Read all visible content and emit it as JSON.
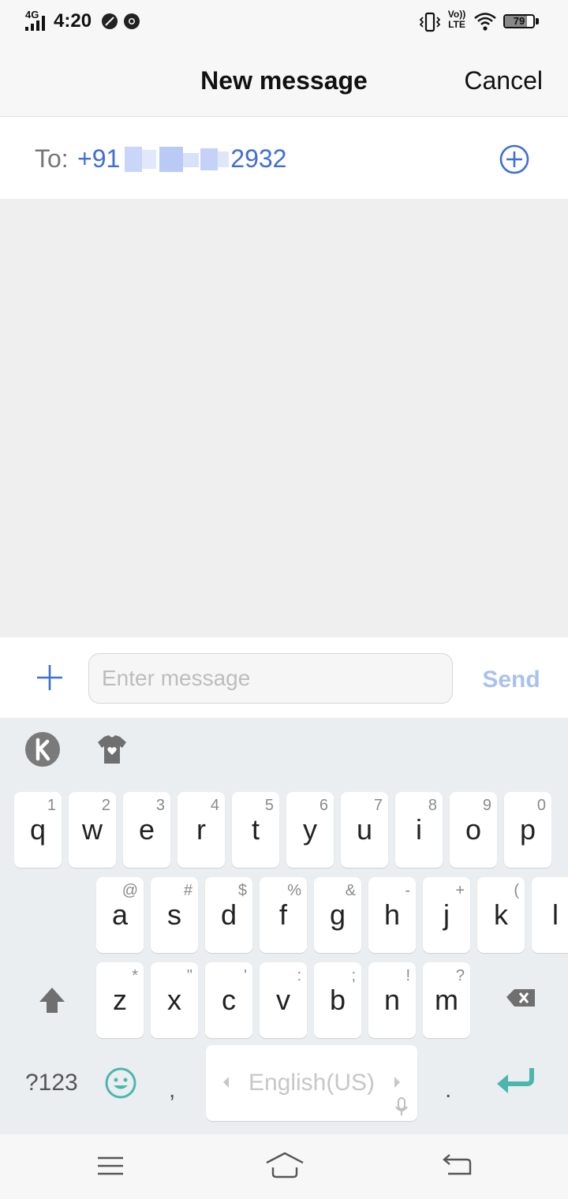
{
  "status_bar": {
    "network": "4G",
    "time": "4:20",
    "volte_top": "Vo))",
    "volte_bottom": "LTE",
    "battery_level": 79,
    "battery_label": "79"
  },
  "header": {
    "title": "New message",
    "cancel_label": "Cancel"
  },
  "recipient": {
    "label": "To:",
    "number_prefix": "+91",
    "number_suffix": "2932",
    "add_icon": "plus-circle-icon"
  },
  "composer": {
    "attach_icon": "plus-icon",
    "placeholder": "Enter message",
    "send_label": "Send"
  },
  "keyboard": {
    "toolbar": [
      "kika-logo-icon",
      "theme-shirt-icon"
    ],
    "row1": [
      {
        "key": "q",
        "hint": "1"
      },
      {
        "key": "w",
        "hint": "2"
      },
      {
        "key": "e",
        "hint": "3"
      },
      {
        "key": "r",
        "hint": "4"
      },
      {
        "key": "t",
        "hint": "5"
      },
      {
        "key": "y",
        "hint": "6"
      },
      {
        "key": "u",
        "hint": "7"
      },
      {
        "key": "i",
        "hint": "8"
      },
      {
        "key": "o",
        "hint": "9"
      },
      {
        "key": "p",
        "hint": "0"
      }
    ],
    "row2": [
      {
        "key": "a",
        "hint": "@"
      },
      {
        "key": "s",
        "hint": "#"
      },
      {
        "key": "d",
        "hint": "$"
      },
      {
        "key": "f",
        "hint": "%"
      },
      {
        "key": "g",
        "hint": "&"
      },
      {
        "key": "h",
        "hint": "-"
      },
      {
        "key": "j",
        "hint": "+"
      },
      {
        "key": "k",
        "hint": "("
      },
      {
        "key": "l",
        "hint": ")"
      }
    ],
    "row3": [
      {
        "key": "z",
        "hint": "*"
      },
      {
        "key": "x",
        "hint": "\""
      },
      {
        "key": "c",
        "hint": "'"
      },
      {
        "key": "v",
        "hint": ":"
      },
      {
        "key": "b",
        "hint": ";"
      },
      {
        "key": "n",
        "hint": "!"
      },
      {
        "key": "m",
        "hint": "?"
      }
    ],
    "symbols_label": "?123",
    "comma": ",",
    "space_label": "English(US)",
    "period": ".",
    "accent_color": "#4db6ac"
  },
  "nav_bar": {
    "buttons": [
      "menu-icon",
      "home-icon",
      "back-icon"
    ]
  }
}
